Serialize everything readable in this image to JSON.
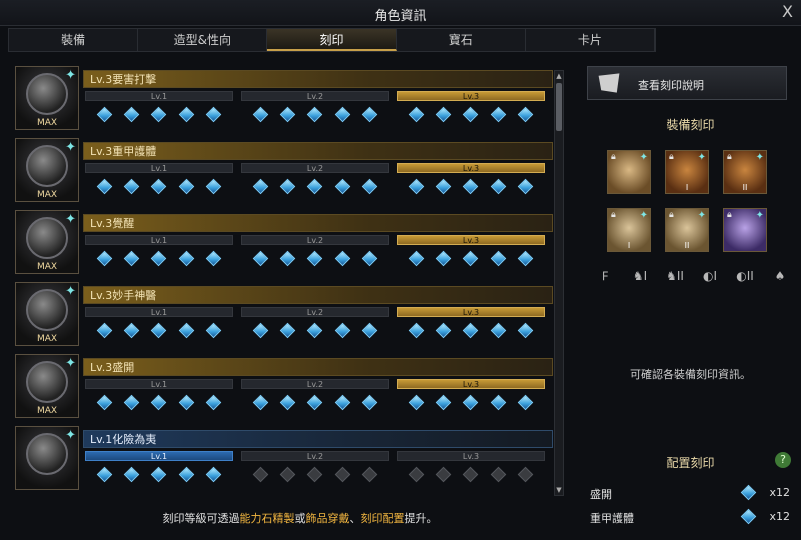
{
  "window": {
    "title": "角色資訊",
    "close_glyph": "X"
  },
  "tabs": [
    "裝備",
    "造型&性向",
    "刻印",
    "寶石",
    "卡片"
  ],
  "active_tab": 2,
  "engravings": [
    {
      "title": "Lv.3要害打擊",
      "badge": "MAX",
      "level": 3,
      "style": "gold",
      "levels": [
        "Lv.1",
        "Lv.2",
        "Lv.3"
      ]
    },
    {
      "title": "Lv.3重甲護體",
      "badge": "MAX",
      "level": 3,
      "style": "gold",
      "levels": [
        "Lv.1",
        "Lv.2",
        "Lv.3"
      ]
    },
    {
      "title": "Lv.3覺醒",
      "badge": "MAX",
      "level": 3,
      "style": "gold",
      "levels": [
        "Lv.1",
        "Lv.2",
        "Lv.3"
      ]
    },
    {
      "title": "Lv.3妙手神醫",
      "badge": "MAX",
      "level": 3,
      "style": "gold",
      "levels": [
        "Lv.1",
        "Lv.2",
        "Lv.3"
      ]
    },
    {
      "title": "Lv.3盛開",
      "badge": "MAX",
      "level": 3,
      "style": "gold",
      "levels": [
        "Lv.1",
        "Lv.2",
        "Lv.3"
      ]
    },
    {
      "title": "Lv.1化險為夷",
      "badge": "",
      "level": 1,
      "style": "blue",
      "levels": [
        "Lv.1",
        "Lv.2",
        "Lv.3"
      ]
    }
  ],
  "hint": {
    "prefix": "刻印等級可透過",
    "gold1": "能力石精製",
    "mid1": "或",
    "gold2": "飾品穿戴",
    "mid2": "、",
    "gold3": "刻印配置",
    "suffix": "提升。"
  },
  "right": {
    "view_button": "查看刻印說明",
    "equipped_title": "裝備刻印",
    "slot_numerals": [
      "",
      "I",
      "II",
      "I",
      "II",
      ""
    ],
    "glyphs": [
      "𝈓",
      "♞I",
      "♞II",
      "◐I",
      "◐II",
      "♠"
    ],
    "empty_message": "可確認各裝備刻印資訊。",
    "config_title": "配置刻印",
    "help_glyph": "?",
    "config": [
      {
        "name": "盛開",
        "count": "x12"
      },
      {
        "name": "重甲護體",
        "count": "x12"
      }
    ]
  },
  "icons": [
    "close-icon",
    "book-icon",
    "lock-icon",
    "sparkle-icon",
    "gem-icon",
    "help-icon",
    "scroll-up-icon",
    "scroll-down-icon"
  ]
}
